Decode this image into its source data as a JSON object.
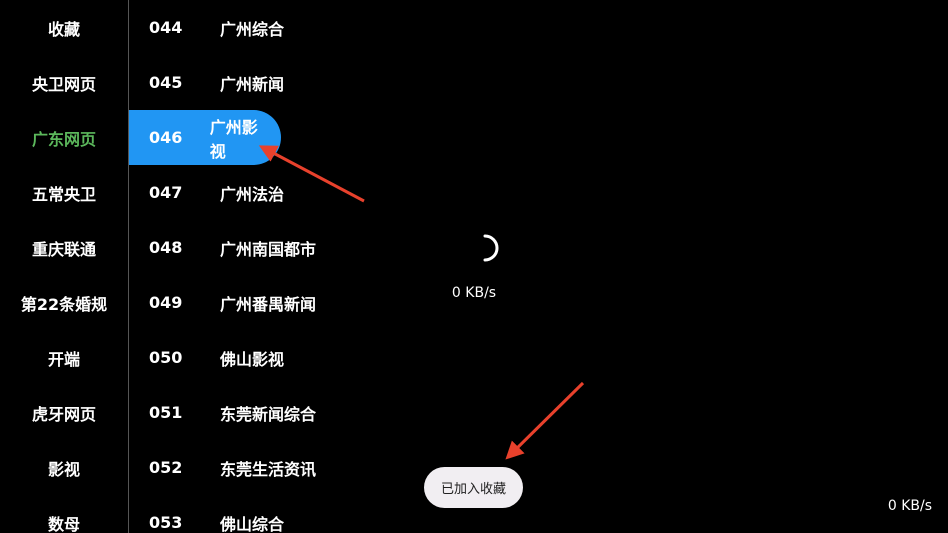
{
  "categories": [
    {
      "label": "收藏",
      "active": false
    },
    {
      "label": "央卫网页",
      "active": false
    },
    {
      "label": "广东网页",
      "active": true
    },
    {
      "label": "五常央卫",
      "active": false
    },
    {
      "label": "重庆联通",
      "active": false
    },
    {
      "label": "第22条婚规",
      "active": false
    },
    {
      "label": "开端",
      "active": false
    },
    {
      "label": "虎牙网页",
      "active": false
    },
    {
      "label": "影视",
      "active": false
    },
    {
      "label": "数母",
      "active": false
    }
  ],
  "channels": [
    {
      "num": "044",
      "name": "广州综合"
    },
    {
      "num": "045",
      "name": "广州新闻"
    },
    {
      "num": "046",
      "name": "广州影视"
    },
    {
      "num": "047",
      "name": "广州法治"
    },
    {
      "num": "048",
      "name": "广州南国都市"
    },
    {
      "num": "049",
      "name": "广州番禺新闻"
    },
    {
      "num": "050",
      "name": "佛山影视"
    },
    {
      "num": "051",
      "name": "东莞新闻综合"
    },
    {
      "num": "052",
      "name": "东莞生活资讯"
    },
    {
      "num": "053",
      "name": "佛山综合"
    }
  ],
  "selected_channel_index": 2,
  "loading": {
    "speed": "0 KB/s"
  },
  "corner_speed": "0 KB/s",
  "toast": {
    "text": "已加入收藏"
  },
  "colors": {
    "active_category": "#5cb85c",
    "selected_channel_bg": "#2196f3",
    "annotation_arrow": "#e8412c",
    "toast_bg": "#f1eef2"
  }
}
